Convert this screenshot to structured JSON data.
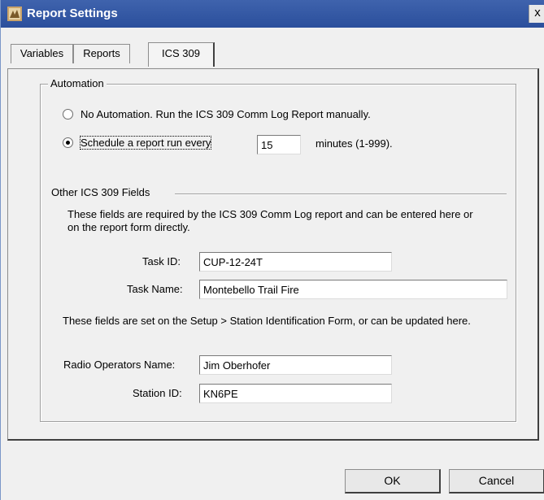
{
  "window": {
    "title": "Report Settings",
    "close_glyph": "x"
  },
  "tabs": [
    {
      "label": "Variables"
    },
    {
      "label": "Reports"
    },
    {
      "label": "ICS 309"
    }
  ],
  "automation": {
    "group_label": "Automation",
    "no_automation_label": "No Automation.  Run the ICS 309 Comm Log Report manually.",
    "schedule_label": "Schedule a report run every",
    "minutes_value": "15",
    "minutes_suffix": "minutes (1-999).",
    "selected": "schedule"
  },
  "other_fields": {
    "section_label": "Other ICS 309 Fields",
    "description": "These fields are required by the ICS 309 Comm Log report and can be entered here or on the report form directly.",
    "task_id_label": "Task ID:",
    "task_id_value": "CUP-12-24T",
    "task_name_label": "Task Name:",
    "task_name_value": "Montebello Trail Fire",
    "station_description": "These fields are set on the Setup > Station Identification Form, or can be updated here.",
    "operator_label": "Radio Operators Name:",
    "operator_value": "Jim Oberhofer",
    "station_id_label": "Station ID:",
    "station_id_value": "KN6PE"
  },
  "buttons": {
    "ok": "OK",
    "cancel": "Cancel"
  }
}
